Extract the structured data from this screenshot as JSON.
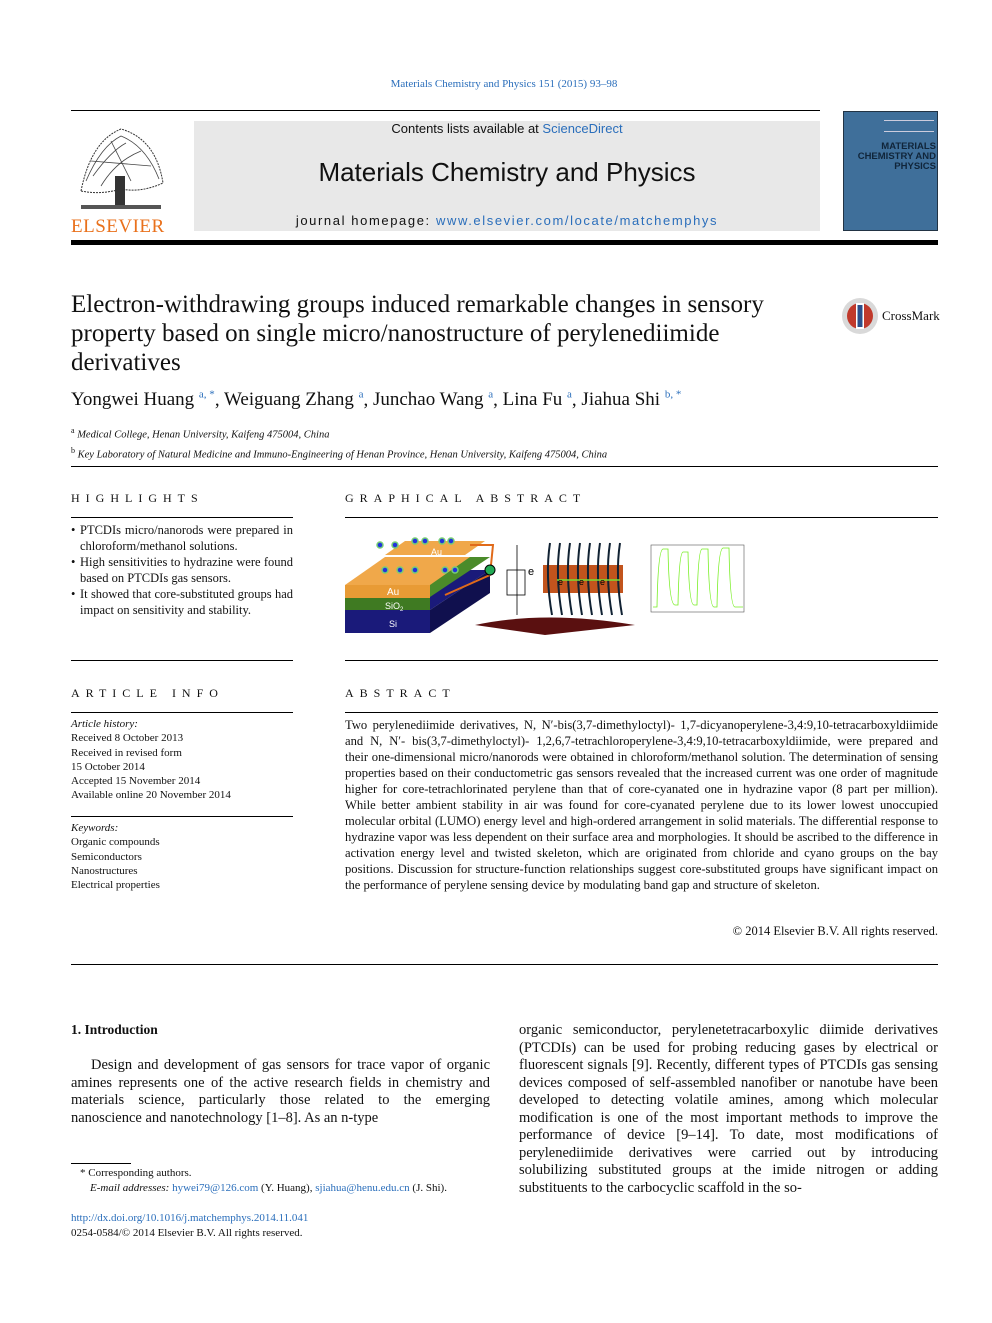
{
  "journal_ref": "Materials Chemistry and Physics 151 (2015) 93–98",
  "header": {
    "contents_prefix": "Contents lists available at ",
    "contents_link": "ScienceDirect",
    "journal_title": "Materials Chemistry and Physics",
    "homepage_prefix": "journal homepage: ",
    "homepage_link": "www.elsevier.com/locate/matchemphys",
    "publisher": "ELSEVIER",
    "cover_title": "MATERIALS CHEMISTRY AND PHYSICS"
  },
  "crossmark": "CrossMark",
  "article": {
    "title": "Electron-withdrawing groups induced remarkable changes in sensory property based on single micro/nanostructure of perylenediimide derivatives",
    "authors": [
      {
        "name": "Yongwei Huang",
        "sup": "a, *"
      },
      {
        "name": "Weiguang Zhang",
        "sup": "a"
      },
      {
        "name": "Junchao Wang",
        "sup": "a"
      },
      {
        "name": "Lina Fu",
        "sup": "a"
      },
      {
        "name": "Jiahua Shi",
        "sup": "b, *"
      }
    ],
    "affiliations": [
      {
        "mark": "a",
        "text": "Medical College, Henan University, Kaifeng 475004, China"
      },
      {
        "mark": "b",
        "text": "Key Laboratory of Natural Medicine and Immuno-Engineering of Henan Province, Henan University, Kaifeng 475004, China"
      }
    ]
  },
  "highlights": {
    "heading": "HIGHLIGHTS",
    "items": [
      "PTCDIs micro/nanorods were prepared in chloroform/methanol solutions.",
      "High sensitivities to hydrazine were found based on PTCDIs gas sensors.",
      "It showed that core-substituted groups had impact on sensitivity and stability."
    ]
  },
  "graphical_abstract": {
    "heading": "GRAPHICAL ABSTRACT",
    "labels": {
      "au": "Au",
      "sio2": "SiO",
      "sio2_sub": "2",
      "si": "Si",
      "electron": "e"
    }
  },
  "article_info": {
    "heading": "ARTICLE INFO",
    "history_label": "Article history:",
    "history": [
      "Received 8 October 2013",
      "Received in revised form",
      "15 October 2014",
      "Accepted 15 November 2014",
      "Available online 20 November 2014"
    ],
    "keywords_label": "Keywords:",
    "keywords": [
      "Organic compounds",
      "Semiconductors",
      "Nanostructures",
      "Electrical properties"
    ]
  },
  "abstract": {
    "heading": "ABSTRACT",
    "text": "Two perylenediimide derivatives, N, N′-bis(3,7-dimethyloctyl)- 1,7-dicyanoperylene-3,4:9,10-tetracarboxyldiimide and N, N′- bis(3,7-dimethyloctyl)- 1,2,6,7-tetrachloroperylene-3,4:9,10-tetracarboxyldiimide, were prepared and their one-dimensional micro/nanorods were obtained in chloroform/methanol solution. The determination of sensing properties based on their conductometric gas sensors revealed that the increased current was one order of magnitude higher for core-tetrachlorinated perylene than that of core-cyanated one in hydrazine vapor (8 part per million). While better ambient stability in air was found for core-cyanated perylene due to its lower lowest unoccupied molecular orbital (LUMO) energy level and high-ordered arrangement in solid materials. The differential response to hydrazine vapor was less dependent on their surface area and morphologies. It should be ascribed to the difference in activation energy level and twisted skeleton, which are originated from chloride and cyano groups on the bay positions. Discussion for structure-function relationships suggest core-substituted groups have significant impact on the performance of perylene sensing device by modulating band gap and structure of skeleton.",
    "copyright": "© 2014 Elsevier B.V. All rights reserved."
  },
  "introduction": {
    "heading": "1.  Introduction",
    "col1": "Design and development of gas sensors for trace vapor of organic amines represents one of the active research fields in chemistry and materials science, particularly those related to the emerging nanoscience and nanotechnology [1–8]. As an n-type",
    "col2": "organic semiconductor, perylenetetracarboxylic diimide derivatives (PTCDIs) can be used for probing reducing gases by electrical or fluorescent signals [9]. Recently, different types of PTCDIs gas sensing devices composed of self-assembled nanofiber or nanotube have been developed to detecting volatile amines, among which molecular modification is one of the most important methods to improve the performance of device [9–14]. To date, most modifications of perylenediimide derivatives were carried out by introducing solubilizing substituted groups at the imide nitrogen or adding substituents to the carbocyclic scaffold in the so-"
  },
  "footnote": {
    "star_text": "* Corresponding authors.",
    "email_label": "E-mail addresses: ",
    "email1": "hywei79@126.com",
    "name1": " (Y. Huang), ",
    "email2": "sjiahua@henu.edu.cn",
    "name2": " (J. Shi)."
  },
  "doi": "http://dx.doi.org/10.1016/j.matchemphys.2014.11.041",
  "issn": "0254-0584/© 2014 Elsevier B.V. All rights reserved."
}
